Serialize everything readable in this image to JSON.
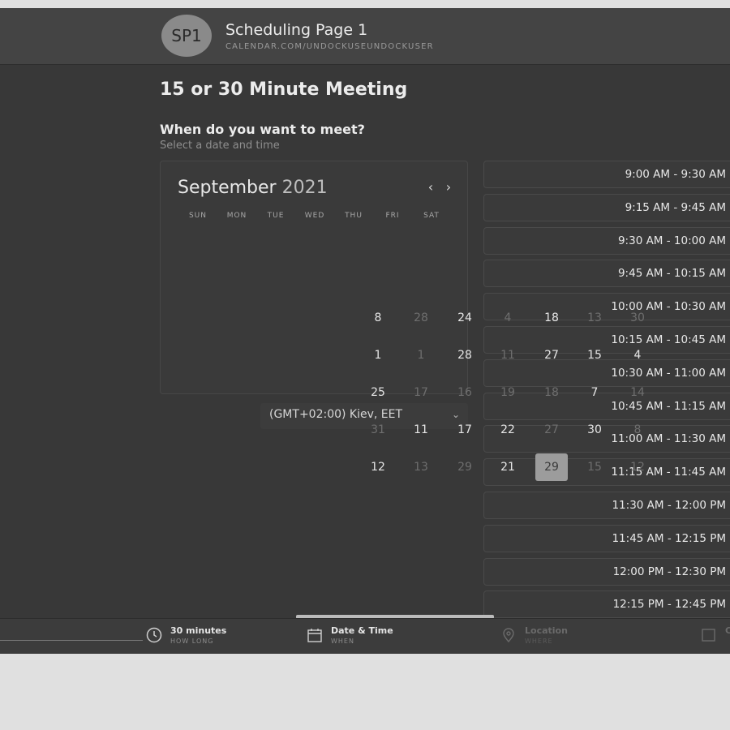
{
  "header": {
    "avatar_initials": "SP1",
    "page_name": "Scheduling Page 1",
    "page_url": "CALENDAR.COM/UNDOCKUSEUNDOCKUSER"
  },
  "meeting": {
    "title": "15 or 30 Minute Meeting",
    "question": "When do you want to meet?",
    "instruction": "Select a date and time"
  },
  "calendar": {
    "month": "September",
    "year": "2021",
    "prev_label": "‹",
    "next_label": "›",
    "weekdays": [
      "SUN",
      "MON",
      "TUE",
      "WED",
      "THU",
      "FRI",
      "SAT"
    ],
    "days": [
      {
        "label": "8"
      },
      {
        "label": "28",
        "dim": true
      },
      {
        "label": "24"
      },
      {
        "label": "4",
        "dim": true
      },
      {
        "label": "18"
      },
      {
        "label": "13",
        "dim": true
      },
      {
        "label": "30",
        "dim": true
      },
      {
        "label": "1"
      },
      {
        "label": "1",
        "dim": true
      },
      {
        "label": "28"
      },
      {
        "label": "11",
        "dim": true
      },
      {
        "label": "27"
      },
      {
        "label": "15"
      },
      {
        "label": "4"
      },
      {
        "label": "25"
      },
      {
        "label": "17",
        "dim": true
      },
      {
        "label": "16",
        "dim": true
      },
      {
        "label": "19",
        "dim": true
      },
      {
        "label": "18",
        "dim": true
      },
      {
        "label": "7"
      },
      {
        "label": "14",
        "dim": true
      },
      {
        "label": "31",
        "dim": true
      },
      {
        "label": "11"
      },
      {
        "label": "17"
      },
      {
        "label": "22"
      },
      {
        "label": "27",
        "dim": true
      },
      {
        "label": "30"
      },
      {
        "label": "8",
        "dim": true
      },
      {
        "label": "12"
      },
      {
        "label": "13",
        "dim": true
      },
      {
        "label": "29",
        "dim": true
      },
      {
        "label": "21"
      },
      {
        "label": "29",
        "selected": true
      },
      {
        "label": "15",
        "dim": true
      },
      {
        "label": "12",
        "dim": true
      }
    ]
  },
  "timezone": {
    "value": "(GMT+02:00) Kiev, EET",
    "caret": "⌄"
  },
  "time_slots": [
    "9:00 AM - 9:30 AM",
    "9:15 AM - 9:45 AM",
    "9:30 AM - 10:00 AM",
    "9:45 AM - 10:15 AM",
    "10:00 AM - 10:30 AM",
    "10:15 AM - 10:45 AM",
    "10:30 AM - 11:00 AM",
    "10:45 AM - 11:15 AM",
    "11:00 AM - 11:30 AM",
    "11:15 AM - 11:45 AM",
    "11:30 AM - 12:00 PM",
    "11:45 AM - 12:15 PM",
    "12:00 PM - 12:30 PM",
    "12:15 PM - 12:45 PM"
  ],
  "footer": {
    "steps": [
      {
        "label": "30 minutes",
        "sub": "HOW LONG",
        "icon": "clock-icon"
      },
      {
        "label": "Date & Time",
        "sub": "WHEN",
        "icon": "calendar-icon"
      },
      {
        "label": "Location",
        "sub": "WHERE",
        "icon": "location-pin-icon"
      },
      {
        "label": "C",
        "sub": "",
        "icon": "contact-card-icon"
      }
    ]
  },
  "colors": {
    "background": "#383838",
    "header": "#444444",
    "selected_day": "#9c9c9c"
  }
}
